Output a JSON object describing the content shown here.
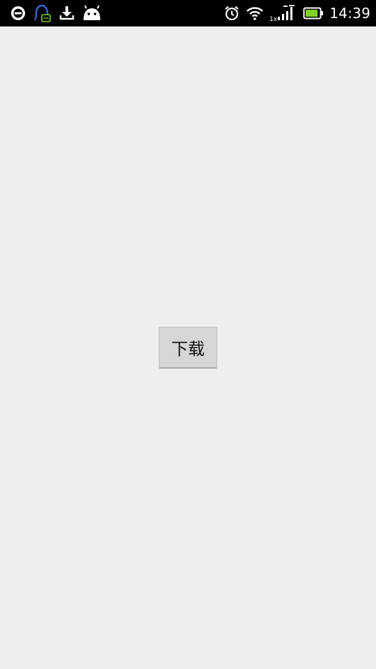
{
  "status_bar": {
    "time": "14:39",
    "network_label": "1x",
    "left_icons": [
      "qq-browser-icon",
      "qq-chat-icon",
      "download-icon",
      "android-debug-icon"
    ],
    "right_icons": [
      "alarm-icon",
      "wifi-icon",
      "signal-icon",
      "battery-icon"
    ],
    "battery_level": 0.85,
    "colors": {
      "background": "#000000",
      "foreground": "#ffffff",
      "battery": "#7ed321",
      "qq_blue": "#2f6fd6"
    }
  },
  "main": {
    "download_button_label": "下载",
    "background_color": "#eeeeee",
    "button_color": "#d6d6d6"
  }
}
